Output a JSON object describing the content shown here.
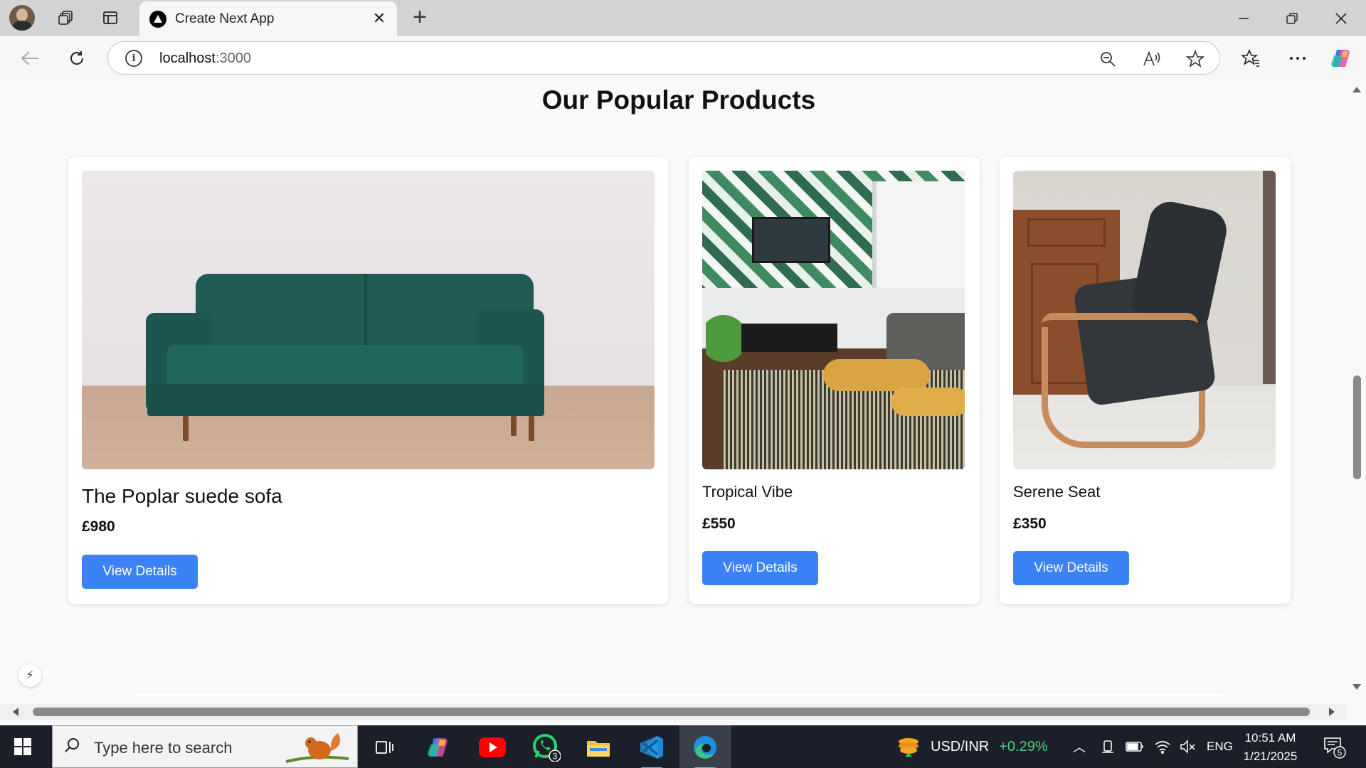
{
  "browser": {
    "tab_title": "Create Next App",
    "url_host": "localhost",
    "url_port": ":3000"
  },
  "page": {
    "title": "Our Popular Products",
    "products": [
      {
        "name": "The Poplar suede sofa",
        "price": "£980",
        "button": "View Details"
      },
      {
        "name": "Tropical Vibe",
        "price": "£550",
        "button": "View Details"
      },
      {
        "name": "Serene Seat",
        "price": "£350",
        "button": "View Details"
      }
    ],
    "button_color": "#3b82f6"
  },
  "taskbar": {
    "search_placeholder": "Type here to search",
    "whatsapp_badge": "3",
    "ticker_label": "USD/INR",
    "ticker_change": "+0.29%",
    "language": "ENG",
    "time": "10:51 AM",
    "date": "1/21/2025",
    "notification_count": "5"
  }
}
